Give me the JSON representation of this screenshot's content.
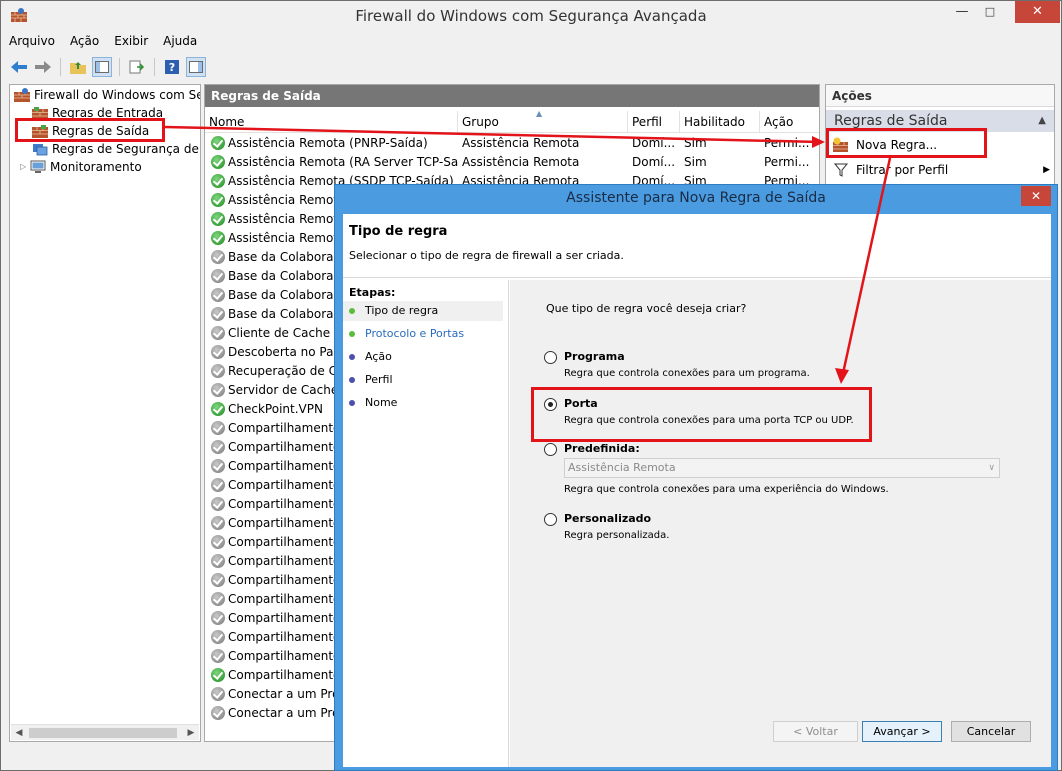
{
  "window": {
    "title": "Firewall do Windows com Segurança Avançada"
  },
  "menu": [
    "Arquivo",
    "Ação",
    "Exibir",
    "Ajuda"
  ],
  "tree": {
    "root": "Firewall do Windows com Segur",
    "items": [
      "Regras de Entrada",
      "Regras de Saída",
      "Regras de Segurança de Co",
      "Monitoramento"
    ]
  },
  "middle": {
    "header": "Regras de Saída",
    "columns": [
      "Nome",
      "Grupo",
      "Perfil",
      "Habilitado",
      "Ação"
    ],
    "rows": [
      {
        "name": "Assistência Remota (PNRP-Saída)",
        "group": "Assistência Remota",
        "profile": "Domí...",
        "enabled": "Sim",
        "action": "Permi...",
        "on": true
      },
      {
        "name": "Assistência Remota (RA Server TCP-Saída)",
        "group": "Assistência Remota",
        "profile": "Domí...",
        "enabled": "Sim",
        "action": "Permi...",
        "on": true
      },
      {
        "name": "Assistência Remota (SSDP TCP-Saída)",
        "group": "Assistência Remota",
        "profile": "Domí...",
        "enabled": "Sim",
        "action": "Permi...",
        "on": true
      },
      {
        "name": "Assistência Remota (",
        "on": true
      },
      {
        "name": "Assistência Remota (",
        "on": true
      },
      {
        "name": "Assistência Remota (",
        "on": true
      },
      {
        "name": "Base da Colaboração",
        "on": false
      },
      {
        "name": "Base da Colaboração",
        "on": false
      },
      {
        "name": "Base da Colaboração",
        "on": false
      },
      {
        "name": "Base da Colaboração",
        "on": false
      },
      {
        "name": "Cliente de Cache Ho",
        "on": false
      },
      {
        "name": "Descoberta no Par d",
        "on": false
      },
      {
        "name": "Recuperação de Cor",
        "on": false
      },
      {
        "name": "Servidor de Cache H",
        "on": false
      },
      {
        "name": "CheckPoint.VPN",
        "on": true
      },
      {
        "name": "Compartilhamento d",
        "on": false
      },
      {
        "name": "Compartilhamento d",
        "on": false
      },
      {
        "name": "Compartilhamento d",
        "on": false
      },
      {
        "name": "Compartilhamento d",
        "on": false
      },
      {
        "name": "Compartilhamento d",
        "on": false
      },
      {
        "name": "Compartilhamento d",
        "on": false
      },
      {
        "name": "Compartilhamento d",
        "on": false
      },
      {
        "name": "Compartilhamento d",
        "on": false
      },
      {
        "name": "Compartilhamento d",
        "on": false
      },
      {
        "name": "Compartilhamento d",
        "on": false
      },
      {
        "name": "Compartilhamento d",
        "on": false
      },
      {
        "name": "Compartilhamento d",
        "on": false
      },
      {
        "name": "Compartilhamento d",
        "on": false
      },
      {
        "name": "Compartilhamento d",
        "on": true
      },
      {
        "name": "Conectar a um Proje",
        "on": false
      },
      {
        "name": "Conectar a um Proje",
        "on": false
      }
    ]
  },
  "actions": {
    "header": "Ações",
    "section": "Regras de Saída",
    "items": [
      "Nova Regra...",
      "Filtrar por Perfil"
    ]
  },
  "dialog": {
    "title": "Assistente para Nova Regra de Saída",
    "heading": "Tipo de regra",
    "description": "Selecionar o tipo de regra de firewall a ser criada.",
    "steps_label": "Etapas:",
    "steps": [
      "Tipo de regra",
      "Protocolo e Portas",
      "Ação",
      "Perfil",
      "Nome"
    ],
    "question": "Que tipo de regra você deseja criar?",
    "options": [
      {
        "label": "Programa",
        "desc": "Regra que controla conexões para um programa.",
        "selected": false
      },
      {
        "label": "Porta",
        "desc": "Regra que controla conexões para uma porta TCP ou UDP.",
        "selected": true
      },
      {
        "label": "Predefinida:",
        "desc": "Regra que controla conexões para uma experiência do Windows.",
        "selected": false
      },
      {
        "label": "Personalizado",
        "desc": "Regra personalizada.",
        "selected": false
      }
    ],
    "predefined_value": "Assistência Remota",
    "buttons": {
      "back": "< Voltar",
      "next": "Avançar >",
      "cancel": "Cancelar"
    }
  },
  "colors": {
    "accent": "#4a9be0",
    "annotation": "#e2141a",
    "pane_header": "#767676"
  }
}
